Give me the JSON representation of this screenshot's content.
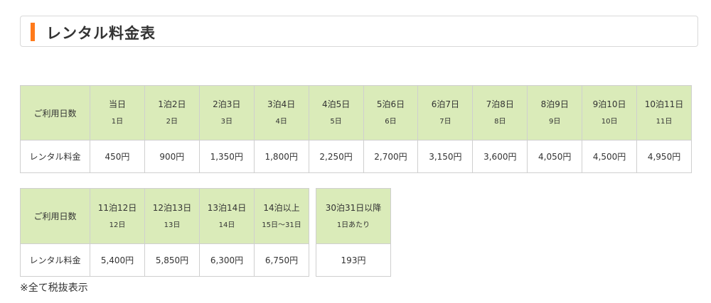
{
  "title": "レンタル料金表",
  "row_header_days": "ご利用日数",
  "row_header_price": "レンタル料金",
  "table1": [
    {
      "label": "当日",
      "sub": "1日",
      "price": "450円"
    },
    {
      "label": "1泊2日",
      "sub": "2日",
      "price": "900円"
    },
    {
      "label": "2泊3日",
      "sub": "3日",
      "price": "1,350円"
    },
    {
      "label": "3泊4日",
      "sub": "4日",
      "price": "1,800円"
    },
    {
      "label": "4泊5日",
      "sub": "5日",
      "price": "2,250円"
    },
    {
      "label": "5泊6日",
      "sub": "6日",
      "price": "2,700円"
    },
    {
      "label": "6泊7日",
      "sub": "7日",
      "price": "3,150円"
    },
    {
      "label": "7泊8日",
      "sub": "8日",
      "price": "3,600円"
    },
    {
      "label": "8泊9日",
      "sub": "9日",
      "price": "4,050円"
    },
    {
      "label": "9泊10日",
      "sub": "10日",
      "price": "4,500円"
    },
    {
      "label": "10泊11日",
      "sub": "11日",
      "price": "4,950円"
    }
  ],
  "table2": [
    {
      "label": "11泊12日",
      "sub": "12日",
      "price": "5,400円"
    },
    {
      "label": "12泊13日",
      "sub": "13日",
      "price": "5,850円"
    },
    {
      "label": "13泊14日",
      "sub": "14日",
      "price": "6,300円"
    },
    {
      "label": "14泊以上",
      "sub": "15日〜31日",
      "price": "6,750円"
    }
  ],
  "table3": {
    "label": "30泊31日以降",
    "sub": "1日あたり",
    "price": "193円"
  },
  "note": "※全て税抜表示",
  "colors": {
    "accent": "#ff7a1a",
    "header_bg": "#daebb9",
    "border": "#cfcfcf"
  }
}
